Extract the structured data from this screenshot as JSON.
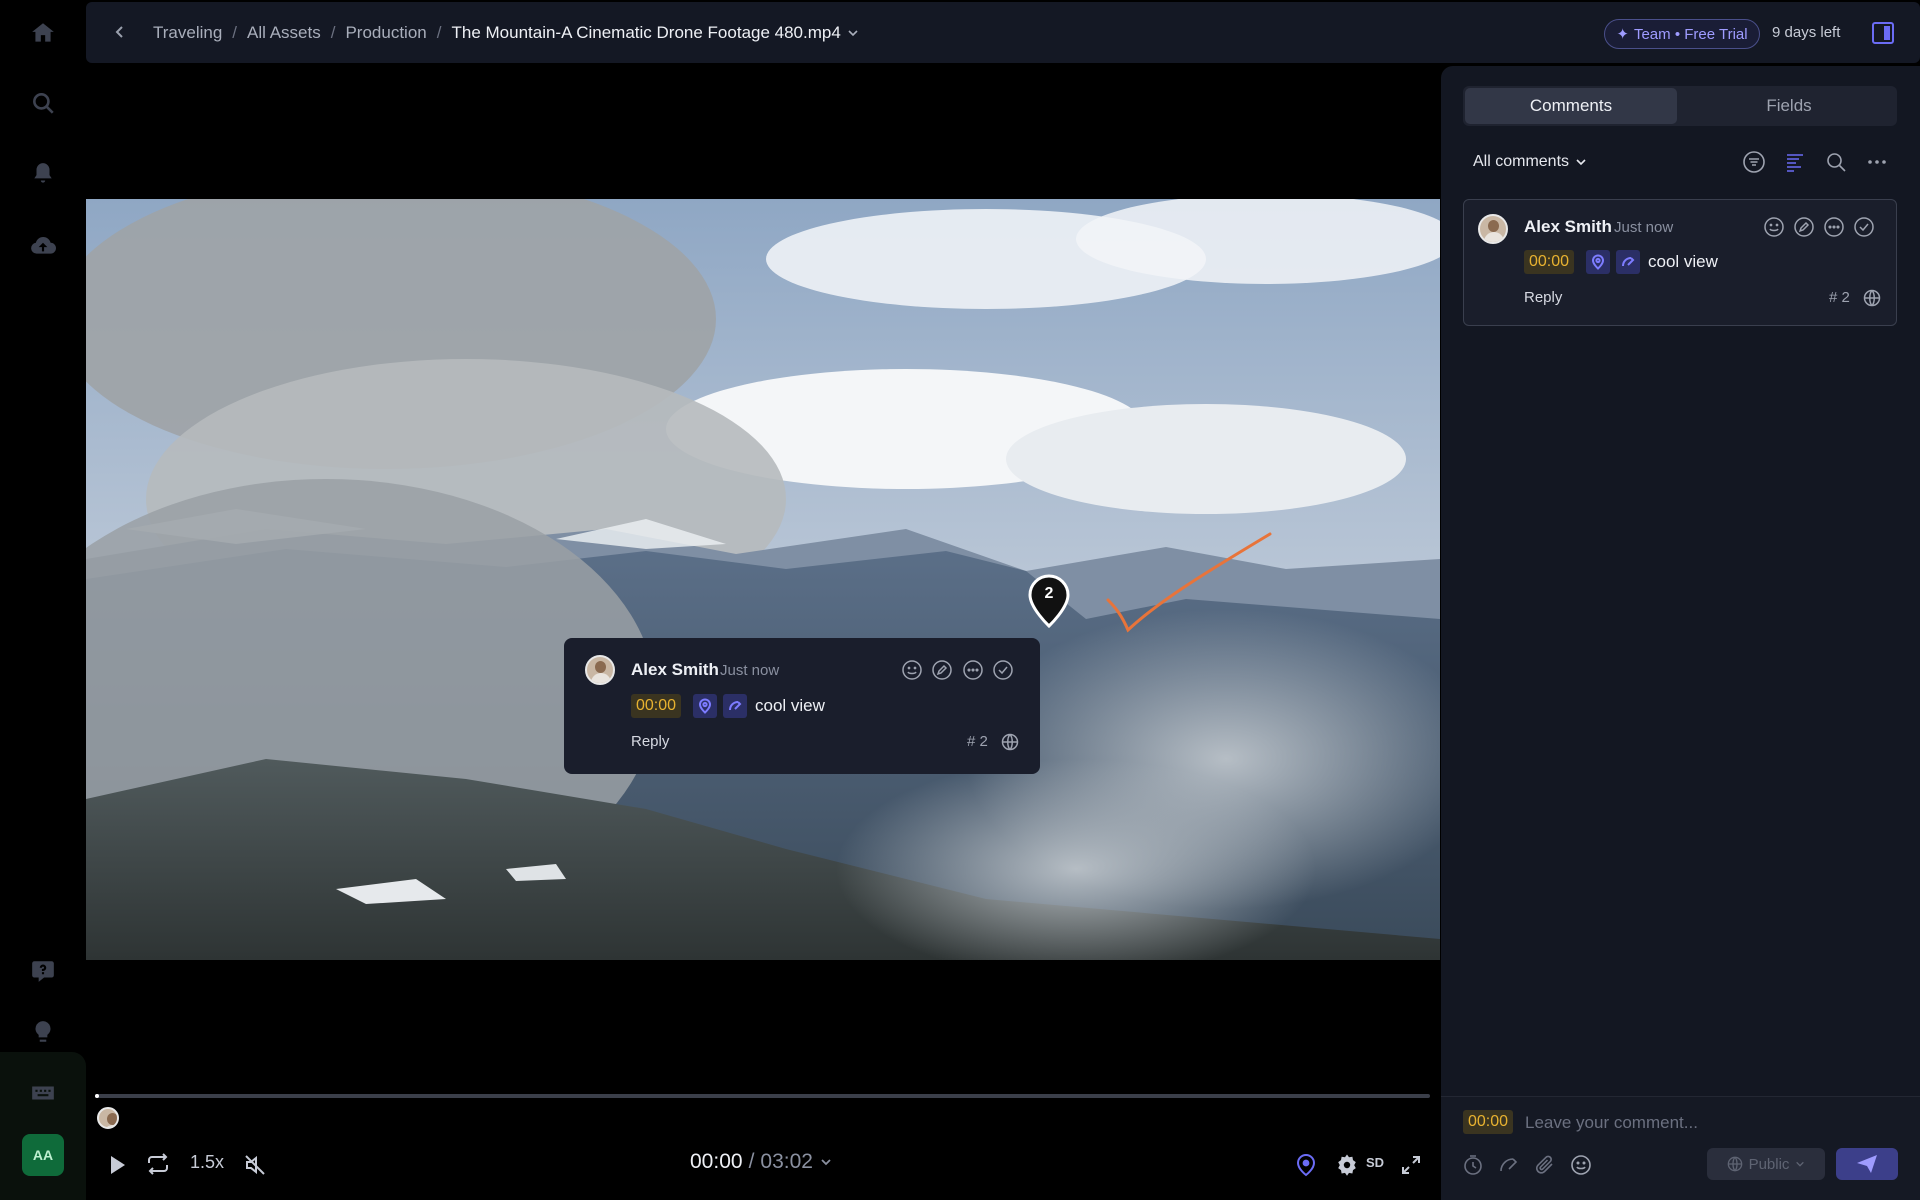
{
  "breadcrumb": {
    "items": [
      "Traveling",
      "All Assets",
      "Production"
    ],
    "separator": "/",
    "current": "The Mountain-A Cinematic Drone Footage 480.mp4"
  },
  "topbar": {
    "trial_label": "Team • Free Trial",
    "days_left": "9 days left"
  },
  "rail": {
    "icons": [
      "home-icon",
      "search-icon",
      "bell-icon",
      "upload-cloud-icon",
      "help-icon",
      "lightbulb-icon",
      "keyboard-icon"
    ],
    "avatar_initials": "AA"
  },
  "video": {
    "pin_number": "2",
    "annotation_color": "#e8743a"
  },
  "comment": {
    "author": "Alex Smith",
    "time": "Just now",
    "timestamp": "00:00",
    "text": "cool view",
    "reply_label": "Reply",
    "number": "# 2",
    "actions": [
      "emoji-icon",
      "edit-icon",
      "more-icon",
      "resolve-check-icon"
    ],
    "chips": [
      "location-pin-icon",
      "draw-icon"
    ]
  },
  "player": {
    "speed": "1.5x",
    "current_time": "00:00",
    "separator": "/",
    "total_time": "03:02",
    "quality": "SD",
    "progress": 0.002
  },
  "panel": {
    "tabs": [
      "Comments",
      "Fields"
    ],
    "active_tab": "Comments",
    "filter": "All comments",
    "tools": [
      "filter-icon",
      "sort-icon",
      "search-icon",
      "more-icon"
    ]
  },
  "composer": {
    "timestamp": "00:00",
    "placeholder": "Leave your comment...",
    "visibility": "Public",
    "accent": "#6b6cf5"
  }
}
